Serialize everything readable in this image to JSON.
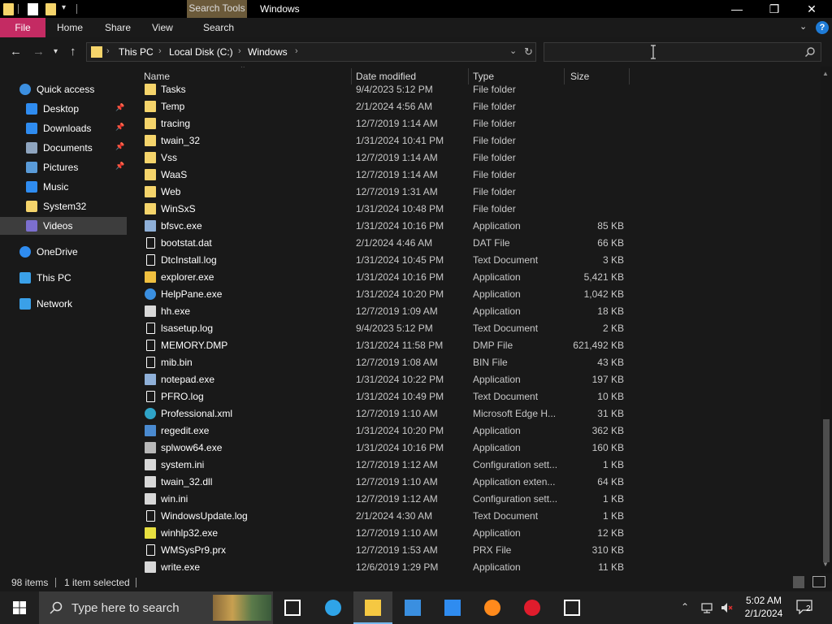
{
  "title_bar": {
    "context_tab": "Search Tools",
    "window_title": "Windows",
    "minimize": "—",
    "maximize": "❐",
    "close": "✕"
  },
  "ribbon": {
    "tabs": [
      "File",
      "Home",
      "Share",
      "View",
      "Search"
    ]
  },
  "address_bar": {
    "breadcrumbs": [
      "This PC",
      "Local Disk (C:)",
      "Windows"
    ]
  },
  "search_box": {
    "value": "",
    "placeholder": ""
  },
  "nav_pane": {
    "items": [
      {
        "label": "Quick access",
        "icon": "star-icon",
        "color": "#3c8fe0"
      },
      {
        "label": "Desktop",
        "icon": "desktop-icon",
        "color": "#2f8cf0",
        "pinned": true
      },
      {
        "label": "Downloads",
        "icon": "download-icon",
        "color": "#2f8cf0",
        "pinned": true
      },
      {
        "label": "Documents",
        "icon": "documents-icon",
        "color": "#8fa5bf",
        "pinned": true
      },
      {
        "label": "Pictures",
        "icon": "pictures-icon",
        "color": "#5a9bd8",
        "pinned": true
      },
      {
        "label": "Music",
        "icon": "music-icon",
        "color": "#2f8cf0"
      },
      {
        "label": "System32",
        "icon": "folder-icon",
        "color": "#f5d46b"
      },
      {
        "label": "Videos",
        "icon": "videos-icon",
        "color": "#7c6fcf",
        "selected": true
      },
      {
        "label": "OneDrive",
        "icon": "cloud-icon",
        "color": "#2f8cf0"
      },
      {
        "label": "This PC",
        "icon": "computer-icon",
        "color": "#3aa0e8"
      },
      {
        "label": "Network",
        "icon": "network-icon",
        "color": "#3aa0e8"
      }
    ]
  },
  "file_list": {
    "columns": [
      "Name",
      "Date modified",
      "Type",
      "Size"
    ],
    "rows": [
      {
        "name": "Tasks",
        "date": "9/4/2023 5:12 PM",
        "type": "File folder",
        "size": "",
        "icon": "folder-icon",
        "color": "#f5d46b"
      },
      {
        "name": "Temp",
        "date": "2/1/2024 4:56 AM",
        "type": "File folder",
        "size": "",
        "icon": "folder-icon",
        "color": "#f5d46b"
      },
      {
        "name": "tracing",
        "date": "12/7/2019 1:14 AM",
        "type": "File folder",
        "size": "",
        "icon": "folder-icon",
        "color": "#f5d46b"
      },
      {
        "name": "twain_32",
        "date": "1/31/2024 10:41 PM",
        "type": "File folder",
        "size": "",
        "icon": "folder-icon",
        "color": "#f5d46b"
      },
      {
        "name": "Vss",
        "date": "12/7/2019 1:14 AM",
        "type": "File folder",
        "size": "",
        "icon": "folder-icon",
        "color": "#f5d46b"
      },
      {
        "name": "WaaS",
        "date": "12/7/2019 1:14 AM",
        "type": "File folder",
        "size": "",
        "icon": "folder-icon",
        "color": "#f5d46b"
      },
      {
        "name": "Web",
        "date": "12/7/2019 1:31 AM",
        "type": "File folder",
        "size": "",
        "icon": "folder-icon",
        "color": "#f5d46b"
      },
      {
        "name": "WinSxS",
        "date": "1/31/2024 10:48 PM",
        "type": "File folder",
        "size": "",
        "icon": "folder-icon",
        "color": "#f5d46b"
      },
      {
        "name": "bfsvc.exe",
        "date": "1/31/2024 10:16 PM",
        "type": "Application",
        "size": "85 KB",
        "icon": "app-icon",
        "color": "#8fb0d8"
      },
      {
        "name": "bootstat.dat",
        "date": "2/1/2024 4:46 AM",
        "type": "DAT File",
        "size": "66 KB",
        "icon": "file-icon",
        "color": "#ffffff"
      },
      {
        "name": "DtcInstall.log",
        "date": "1/31/2024 10:45 PM",
        "type": "Text Document",
        "size": "3 KB",
        "icon": "text-file-icon",
        "color": "#ffffff"
      },
      {
        "name": "explorer.exe",
        "date": "1/31/2024 10:16 PM",
        "type": "Application",
        "size": "5,421 KB",
        "icon": "explorer-icon",
        "color": "#f0c040"
      },
      {
        "name": "HelpPane.exe",
        "date": "1/31/2024 10:20 PM",
        "type": "Application",
        "size": "1,042 KB",
        "icon": "help-icon",
        "color": "#3a8fe0"
      },
      {
        "name": "hh.exe",
        "date": "12/7/2019 1:09 AM",
        "type": "Application",
        "size": "18 KB",
        "icon": "help-file-icon",
        "color": "#d8d8d8"
      },
      {
        "name": "lsasetup.log",
        "date": "9/4/2023 5:12 PM",
        "type": "Text Document",
        "size": "2 KB",
        "icon": "text-file-icon",
        "color": "#ffffff"
      },
      {
        "name": "MEMORY.DMP",
        "date": "1/31/2024 11:58 PM",
        "type": "DMP File",
        "size": "621,492 KB",
        "icon": "file-icon",
        "color": "#ffffff"
      },
      {
        "name": "mib.bin",
        "date": "12/7/2019 1:08 AM",
        "type": "BIN File",
        "size": "43 KB",
        "icon": "file-icon",
        "color": "#ffffff"
      },
      {
        "name": "notepad.exe",
        "date": "1/31/2024 10:22 PM",
        "type": "Application",
        "size": "197 KB",
        "icon": "notepad-icon",
        "color": "#8fb0d8"
      },
      {
        "name": "PFRO.log",
        "date": "1/31/2024 10:49 PM",
        "type": "Text Document",
        "size": "10 KB",
        "icon": "text-file-icon",
        "color": "#ffffff"
      },
      {
        "name": "Professional.xml",
        "date": "12/7/2019 1:10 AM",
        "type": "Microsoft Edge H...",
        "size": "31 KB",
        "icon": "edge-icon",
        "color": "#2fa4c8"
      },
      {
        "name": "regedit.exe",
        "date": "1/31/2024 10:20 PM",
        "type": "Application",
        "size": "362 KB",
        "icon": "regedit-icon",
        "color": "#4a8ad0"
      },
      {
        "name": "splwow64.exe",
        "date": "1/31/2024 10:16 PM",
        "type": "Application",
        "size": "160 KB",
        "icon": "printer-icon",
        "color": "#b8b8b8"
      },
      {
        "name": "system.ini",
        "date": "12/7/2019 1:12 AM",
        "type": "Configuration sett...",
        "size": "1 KB",
        "icon": "settings-file-icon",
        "color": "#d8d8d8"
      },
      {
        "name": "twain_32.dll",
        "date": "12/7/2019 1:10 AM",
        "type": "Application exten...",
        "size": "64 KB",
        "icon": "dll-icon",
        "color": "#d8d8d8"
      },
      {
        "name": "win.ini",
        "date": "12/7/2019 1:12 AM",
        "type": "Configuration sett...",
        "size": "1 KB",
        "icon": "settings-file-icon",
        "color": "#d8d8d8"
      },
      {
        "name": "WindowsUpdate.log",
        "date": "2/1/2024 4:30 AM",
        "type": "Text Document",
        "size": "1 KB",
        "icon": "text-file-icon",
        "color": "#ffffff"
      },
      {
        "name": "winhlp32.exe",
        "date": "12/7/2019 1:10 AM",
        "type": "Application",
        "size": "12 KB",
        "icon": "help-question-icon",
        "color": "#e8e040"
      },
      {
        "name": "WMSysPr9.prx",
        "date": "12/7/2019 1:53 AM",
        "type": "PRX File",
        "size": "310 KB",
        "icon": "file-icon",
        "color": "#ffffff"
      },
      {
        "name": "write.exe",
        "date": "12/6/2019 1:29 PM",
        "type": "Application",
        "size": "11 KB",
        "icon": "write-icon",
        "color": "#d8d8d8"
      }
    ]
  },
  "status_bar": {
    "item_count": "98 items",
    "selection": "1 item selected"
  },
  "taskbar": {
    "search_text": "Type here to search",
    "apps": [
      {
        "name": "task-view",
        "icon": "task-view-icon",
        "color": "#ffffff"
      },
      {
        "name": "edge",
        "icon": "edge-icon",
        "color": "#2fa4e8"
      },
      {
        "name": "file-explorer",
        "icon": "file-explorer-icon",
        "color": "#f5c842",
        "active": true
      },
      {
        "name": "store",
        "icon": "store-icon",
        "color": "#3a8fe0"
      },
      {
        "name": "mail",
        "icon": "mail-icon",
        "color": "#2f8cf0"
      },
      {
        "name": "firefox",
        "icon": "firefox-icon",
        "color": "#ff8a1c"
      },
      {
        "name": "opera",
        "icon": "opera-icon",
        "color": "#e01c2c"
      },
      {
        "name": "7zip",
        "icon": "7zip-icon",
        "color": "#ffffff"
      }
    ],
    "clock_time": "5:02 AM",
    "clock_date": "2/1/2024",
    "notification_count": "2"
  }
}
